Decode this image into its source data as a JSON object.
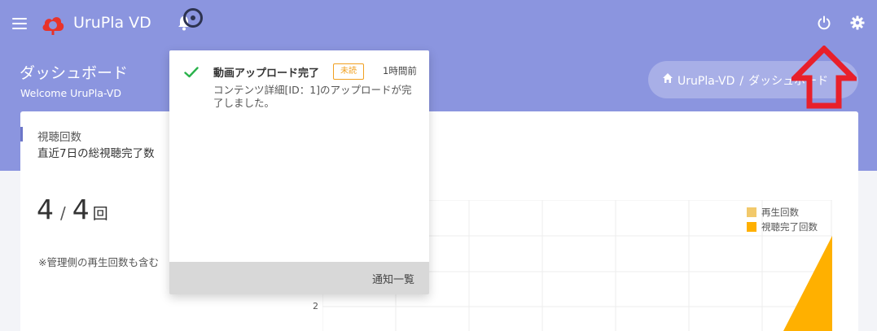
{
  "app": {
    "brand": "UruPla VD"
  },
  "header": {
    "title": "ダッシュボード",
    "subtitle": "Welcome UruPla-VD",
    "breadcrumb": {
      "home": "UruPla-VD",
      "separator": "/",
      "current": "ダッシュボード"
    }
  },
  "card": {
    "label": "視聴回数",
    "sublabel": "直近7日の総視聴完了数",
    "count": "4",
    "slash": "/",
    "total": "4",
    "unit": "回",
    "note": "※管理側の再生回数も含む"
  },
  "chart_data": {
    "type": "area",
    "series": [
      {
        "name": "再生回数",
        "color": "#f2c96b"
      },
      {
        "name": "視聴完了回数",
        "color": "#ffb000"
      }
    ],
    "y_tick_visible": "2"
  },
  "notification": {
    "title": "動画アップロード完了",
    "badge": "未読",
    "time": "1時間前",
    "body": "コンテンツ詳細[ID：1]のアップロードが完了しました。",
    "footer_link": "通知一覧"
  },
  "icons": {
    "menu": "hamburger-icon",
    "logo": "cloud-logo-icon",
    "notifications": "bell-icon",
    "power": "power-icon",
    "settings": "gear-icon",
    "home": "home-icon",
    "success": "checkmark-icon"
  },
  "colors": {
    "header": "#8b95df",
    "accent": "#6c76c8",
    "badge": "#f0a020",
    "annotation": "#e8202a"
  }
}
